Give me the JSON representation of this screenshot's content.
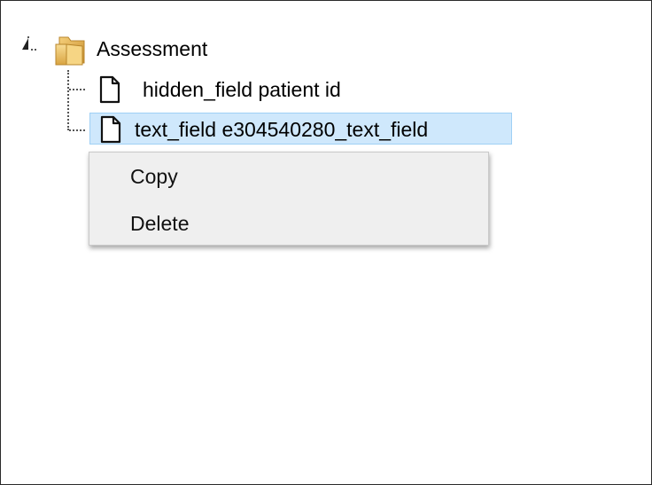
{
  "tree": {
    "root": {
      "label": "Assessment",
      "icon": "folder-icon",
      "expanded": true
    },
    "children": [
      {
        "label": "hidden_field patient id",
        "icon": "document-icon",
        "selected": false
      },
      {
        "label": "text_field e304540280_text_field",
        "icon": "document-icon",
        "selected": true
      }
    ]
  },
  "context_menu": {
    "items": [
      {
        "label": "Copy"
      },
      {
        "label": "Delete"
      }
    ]
  },
  "colors": {
    "selection_bg": "#cfe8fc",
    "selection_border": "#9fd0f5",
    "menu_bg": "#efefef",
    "folder_fill": "#f3c96b"
  }
}
